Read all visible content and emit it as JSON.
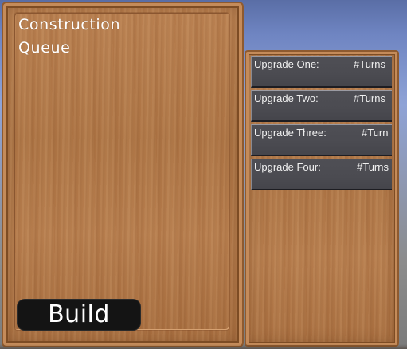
{
  "construction_queue": {
    "title": "Construction\nQueue",
    "build_label": "Build"
  },
  "upgrades": {
    "items": [
      {
        "name": "Upgrade One:",
        "turns": "#Turns"
      },
      {
        "name": "Upgrade Two:",
        "turns": "#Turns"
      },
      {
        "name": "Upgrade Three:",
        "turns": "#Turn"
      },
      {
        "name": "Upgrade Four:",
        "turns": "#Turns"
      }
    ]
  },
  "colors": {
    "wood": "#b47a4b",
    "wood_border": "#8e5a2f",
    "upgrade_row_bg": "#4b4b51",
    "build_button_bg": "#141414",
    "text": "#ffffff"
  }
}
